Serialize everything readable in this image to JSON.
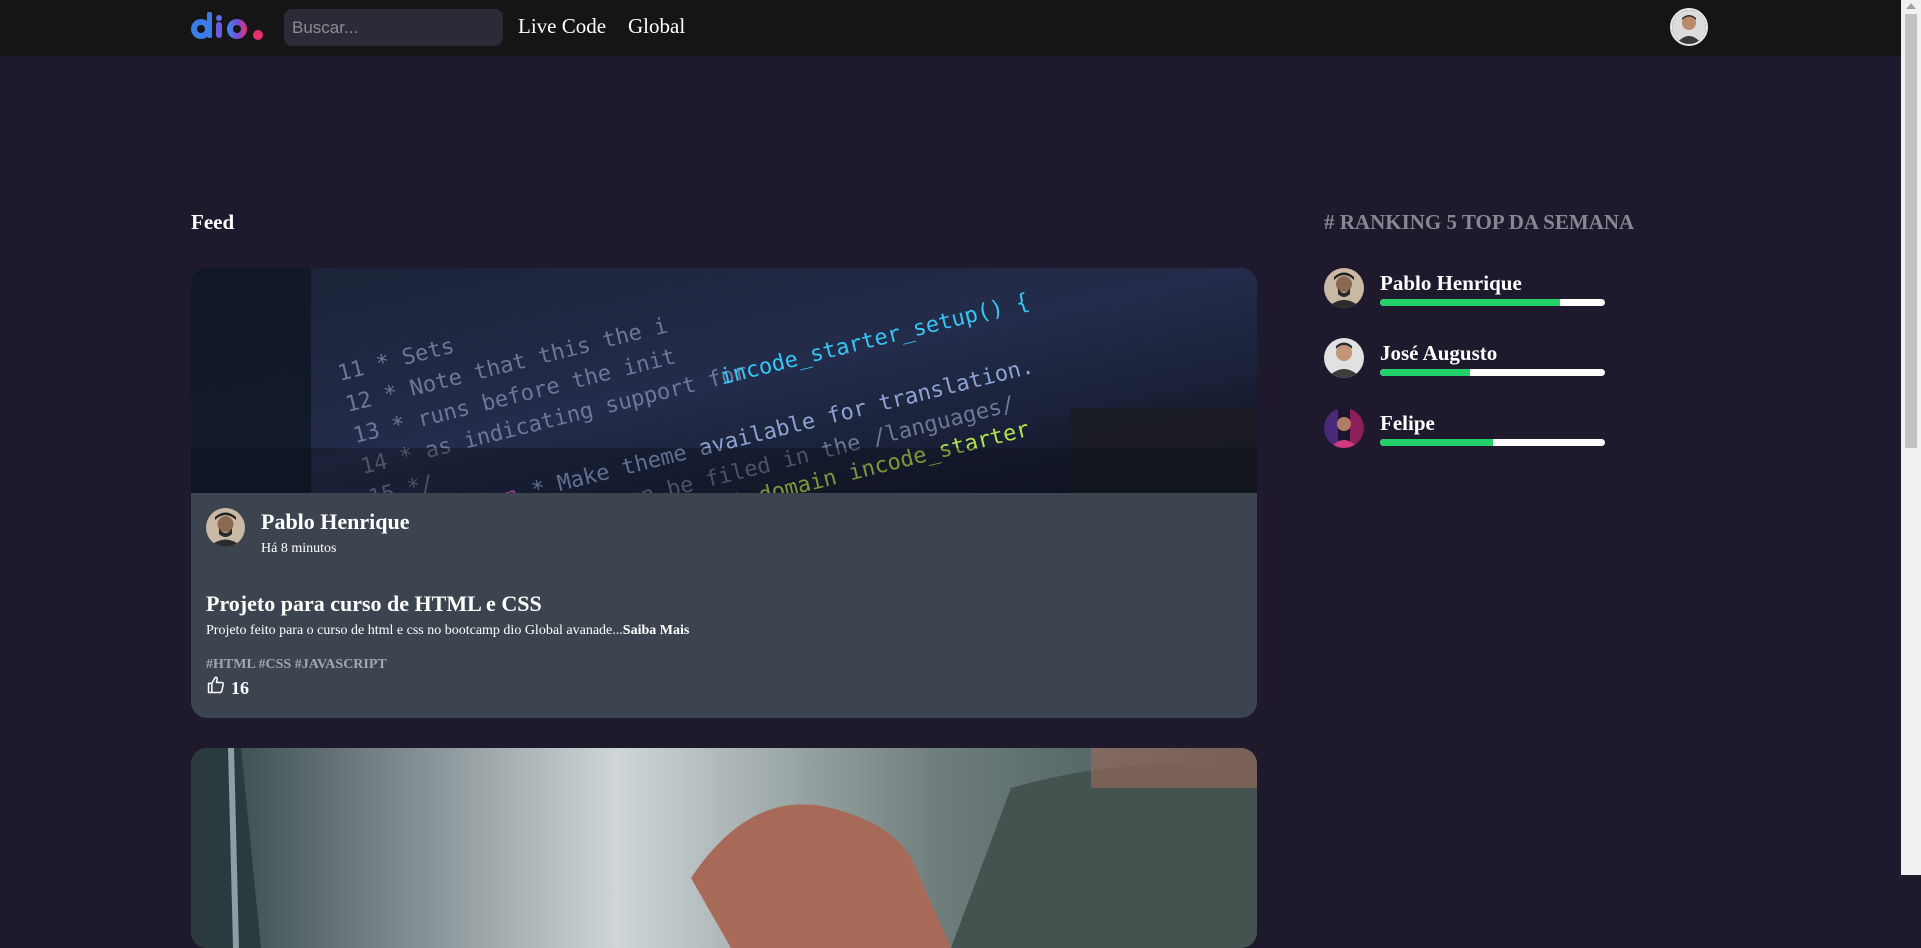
{
  "header": {
    "logo_text": "dio.",
    "search_placeholder": "Buscar...",
    "nav": [
      {
        "label": "Live Code"
      },
      {
        "label": "Global"
      }
    ]
  },
  "feed": {
    "title": "Feed",
    "posts": [
      {
        "author": "Pablo Henrique",
        "time": "Há 8 minutos",
        "title": "Projeto para curso de HTML e CSS",
        "description": "Projeto feito para o curso de html e css no bootcamp dio Global avanade...",
        "read_more": "Saiba Mais",
        "tags": "#HTML #CSS #JAVASCRIPT",
        "likes": "16"
      }
    ]
  },
  "ranking": {
    "title": "# RANKING 5 TOP DA SEMANA",
    "users": [
      {
        "name": "Pablo Henrique",
        "progress": 0.8
      },
      {
        "name": "José Augusto",
        "progress": 0.4
      },
      {
        "name": "Felipe",
        "progress": 0.5
      }
    ]
  },
  "colors": {
    "background": "#1e192c",
    "header": "#151515",
    "card": "#3c454f",
    "progress_fill": "#23d16b",
    "logo_blue": "#3b6ff0",
    "logo_pink": "#e6306b"
  },
  "icons": {
    "like": "thumbs-up-icon",
    "logo": "dio-logo"
  }
}
